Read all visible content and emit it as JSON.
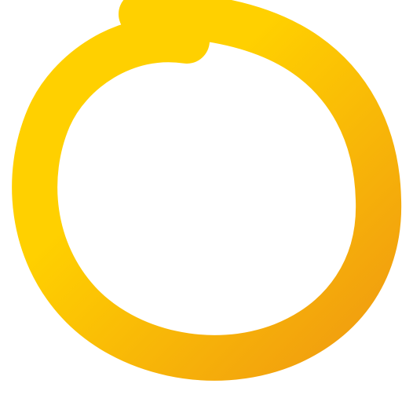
{
  "icon": {
    "name": "hand-drawn-circle-icon",
    "colors": {
      "start": "#FFD000",
      "end": "#F09A10",
      "background": "#FFFFFF"
    }
  }
}
